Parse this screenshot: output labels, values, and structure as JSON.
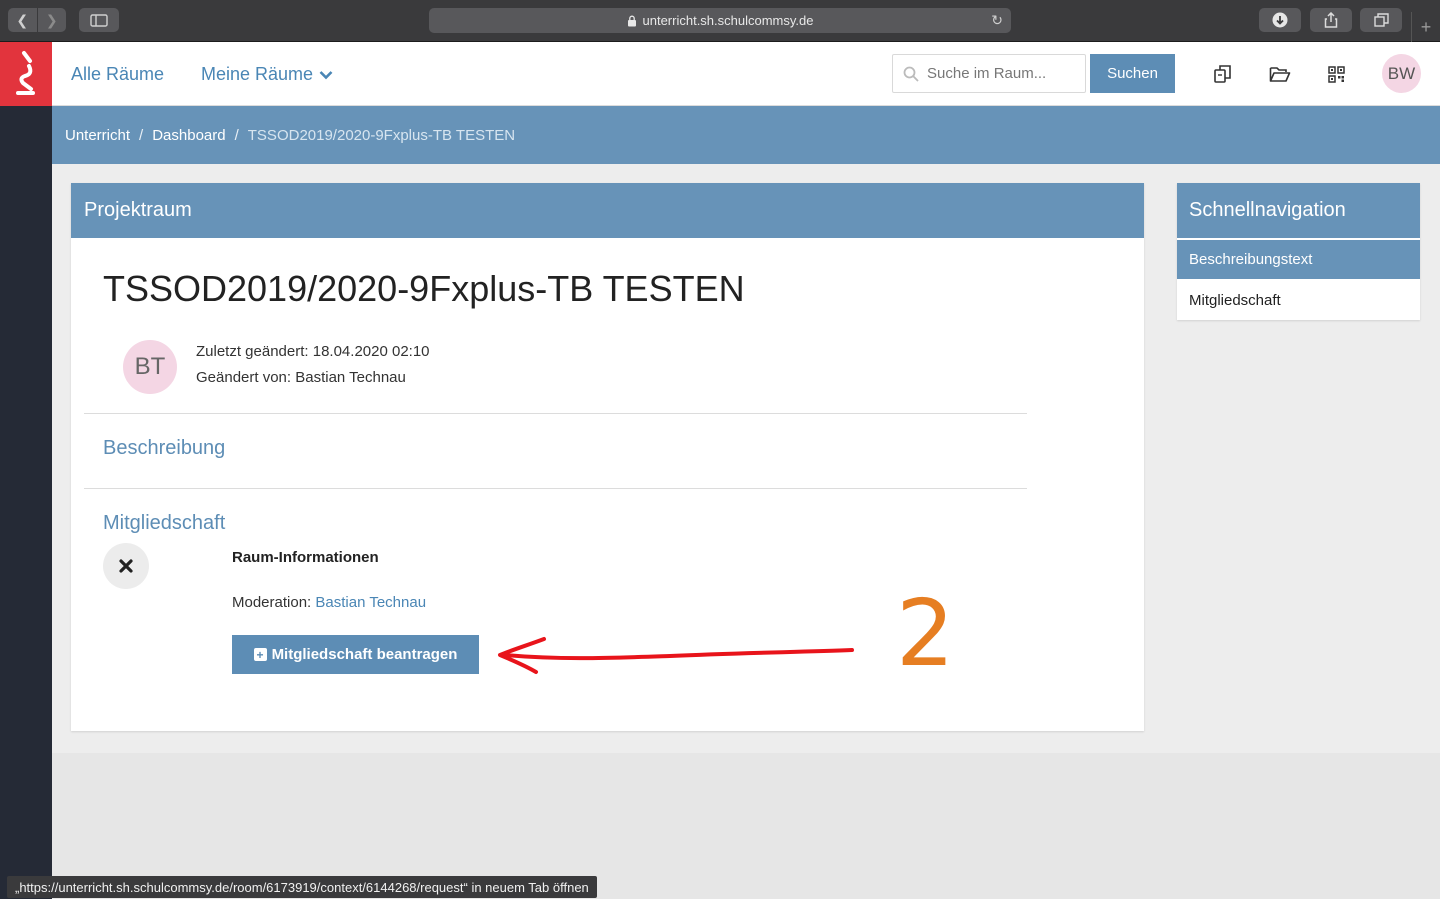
{
  "browser": {
    "url": "unterricht.sh.schulcommsy.de",
    "status_url": "„https://unterricht.sh.schulcommsy.de/room/6173919/context/6144268/request“ in neuem Tab öffnen"
  },
  "header": {
    "nav": {
      "all_rooms": "Alle Räume",
      "my_rooms": "Meine Räume"
    },
    "search": {
      "placeholder": "Suche im Raum...",
      "button": "Suchen"
    },
    "user_initials": "BW"
  },
  "breadcrumb": {
    "items": [
      "Unterricht",
      "Dashboard",
      "TSSOD2019/2020-9Fxplus-TB TESTEN"
    ],
    "separator": "/"
  },
  "room": {
    "card_title": "Projektraum",
    "title": "TSSOD2019/2020-9Fxplus-TB TESTEN",
    "author_initials": "BT",
    "last_changed": "Zuletzt geändert: 18.04.2020 02:10",
    "changed_by": "Geändert von: Bastian Technau",
    "description_title": "Beschreibung",
    "membership_title": "Mitgliedschaft",
    "info_heading": "Raum-Informationen",
    "moderation_label": "Moderation:",
    "moderator": "Bastian Technau",
    "request_button": "Mitgliedschaft beantragen"
  },
  "quicknav": {
    "title": "Schnellnavigation",
    "items": [
      {
        "label": "Beschreibungstext",
        "active": true
      },
      {
        "label": "Mitgliedschaft",
        "active": false
      }
    ]
  },
  "annotation": {
    "number": "2",
    "color": "#e67e22",
    "arrow_color": "#e8141b"
  },
  "colors": {
    "accent": "#6793b8",
    "button": "#5d8db5",
    "link": "#4a86b5",
    "logo": "#e2343d",
    "sidebar": "#252a36"
  }
}
